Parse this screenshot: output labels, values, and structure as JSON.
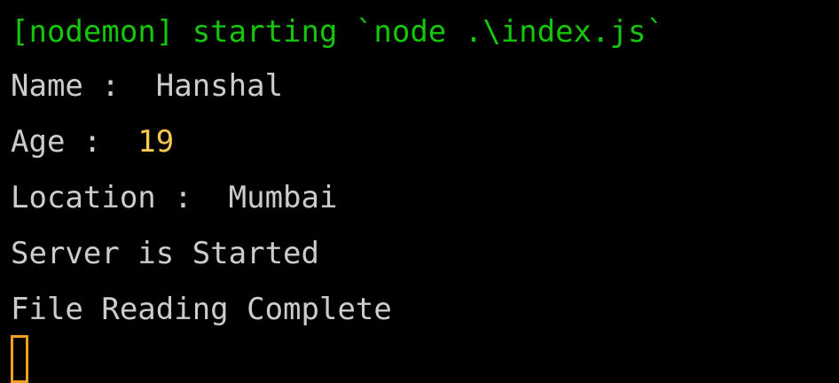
{
  "terminal": {
    "lines": [
      {
        "text": "[nodemon] starting `node .\\index.js`"
      },
      {
        "label": "Name : ",
        "value": " Hanshal"
      },
      {
        "label": "Age : ",
        "value": " 19"
      },
      {
        "label": "Location : ",
        "value": " Mumbai"
      },
      {
        "text": "Server is Started"
      },
      {
        "text": "File Reading Complete"
      }
    ],
    "colors": {
      "background": "#000000",
      "text": "#cccccc",
      "nodemon": "#16c60c",
      "number": "#f9c74f",
      "cursor": "#f0a020"
    },
    "cursor_icon": "block-cursor"
  }
}
